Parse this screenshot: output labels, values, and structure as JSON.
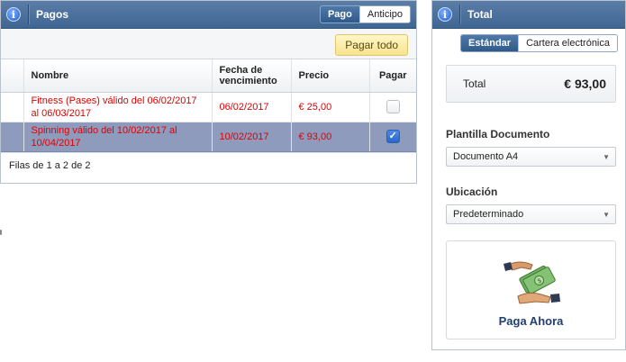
{
  "pagos_panel": {
    "title": "Pagos",
    "tabs": [
      {
        "label": "Pago",
        "active": true
      },
      {
        "label": "Anticipo",
        "active": false
      }
    ],
    "pay_all_button": "Pagar todo",
    "columns": [
      "Nombre",
      "Fecha de vencimiento",
      "Precio",
      "Pagar"
    ],
    "rows": [
      {
        "name": "Fitness (Pases) válido del 06/02/2017 al 06/03/2017",
        "due_date": "06/02/2017",
        "price": "€ 25,00",
        "pay_checked": false
      },
      {
        "name": "Spinning válido del 10/02/2017 al 10/04/2017",
        "due_date": "10/02/2017",
        "price": "€ 93,00",
        "pay_checked": true
      }
    ],
    "footer": "Filas de 1 a 2 de 2"
  },
  "total_panel": {
    "title": "Total",
    "tabs": [
      {
        "label": "Estándar",
        "active": true
      },
      {
        "label": "Cartera electrónica",
        "active": false
      }
    ],
    "total_label": "Total",
    "total_value": "€ 93,00",
    "template_label": "Plantilla Documento",
    "template_value": "Documento A4",
    "location_label": "Ubicación",
    "location_value": "Predeterminado",
    "pay_now_label": "Paga Ahora"
  },
  "colors": {
    "header_blue": "#3f6592",
    "row_text_red": "#e00000",
    "selected_row": "#8e9bbd",
    "pay_now_text": "#1f3f73"
  }
}
